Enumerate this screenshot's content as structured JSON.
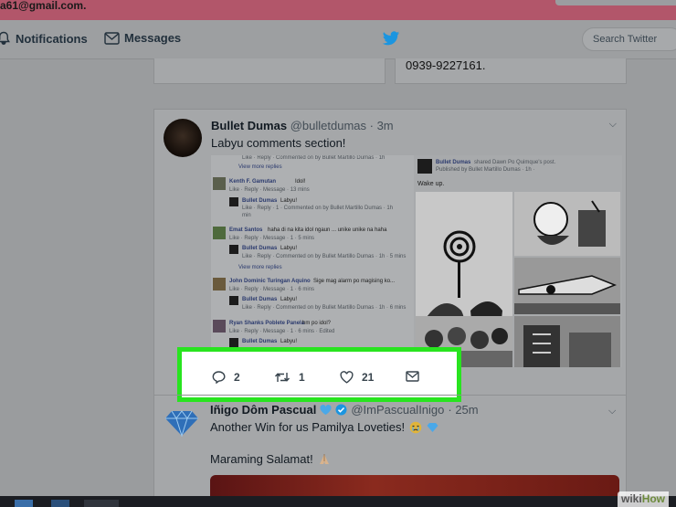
{
  "banner": {
    "email_text": "a61@gmail.com."
  },
  "nav": {
    "notifications_label": "Notifications",
    "messages_label": "Messages",
    "search_placeholder": "Search Twitter"
  },
  "prev_tweet": {
    "phone": "0939-9227161."
  },
  "tweet1": {
    "name": "Bullet Dumas",
    "handle": "@bulletdumas",
    "time": "· 3m",
    "text": "Labyu comments section!",
    "embedded": {
      "left": {
        "top_line": "Like · Reply · Commented on by Bullet Martillo Dumas · 1h",
        "view_more_1": "View more replies",
        "c1_name": "Kenth F. Gamutan",
        "c1_text": "Idol!",
        "c1_meta": "Like · Reply · Message · 13 mins",
        "r1_name": "Bullet Dumas",
        "r1_text": "Labyu!",
        "r1_meta": "Like · Reply · 1 · Commented on by Bullet Martillo Dumas · 1h",
        "r1_meta2": "min",
        "c2_name": "Emat Santos",
        "c2_text": "haha di na kita idol ngaun ... unike unike na haha",
        "c2_meta": "Like · Reply · Message · 1 · 5 mins",
        "r2_name": "Bullet Dumas",
        "r2_text": "Labyu!",
        "r2_meta": "Like · Reply · Commented on by Bullet Martillo Dumas · 1h · 5 mins",
        "view_more_2": "View more replies",
        "c3_name": "John Dominic Turingan Aquino",
        "c3_text": "Sige mag alarm po magising ko...",
        "c3_meta": "Like · Reply · Message · 1 · 6 mins",
        "r3_name": "Bullet Dumas",
        "r3_text": "Labyu!",
        "r3_meta": "Like · Reply · Commented on by Bullet Martillo Dumas · 1h · 6 mins",
        "c4_name": "Ryan Shanks Poblete Panela",
        "c4_text": "hm po idol?",
        "c4_meta": "Like · Reply · Message · 1 · 6 mins · Edited",
        "r4_name": "Bullet Dumas",
        "r4_text": "Labyu!"
      },
      "right": {
        "post_name": "Bullet Dumas",
        "post_action": "shared Dawn Po Quimque's post.",
        "post_meta": "Published by Bullet Martillo Dumas · 1h ·",
        "post_text": "Wake up."
      }
    },
    "actions": {
      "replies": "2",
      "retweets": "1",
      "likes": "21"
    }
  },
  "tweet2": {
    "name": "Iñigo Dôm Pascual",
    "handle": "@ImPascualInigo",
    "time": "· 25m",
    "line1": "Another Win for us Pamilya Loveties!",
    "line2": "Maraming Salamat!"
  },
  "watermark": {
    "wiki": "wiki",
    "how": "How"
  },
  "colors": {
    "highlight": "#28e41f",
    "twitter_blue": "#1b95e0",
    "banner": "#b2566a"
  }
}
